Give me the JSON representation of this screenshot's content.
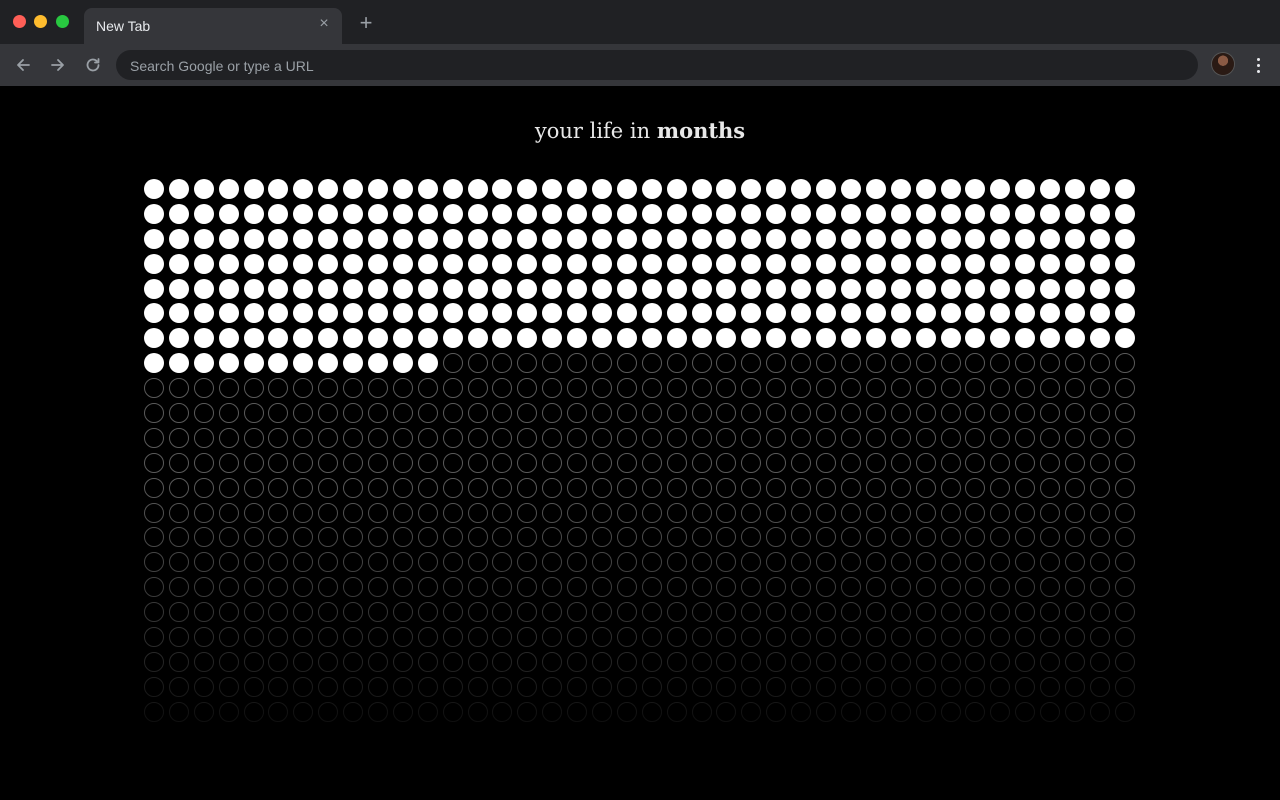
{
  "browser": {
    "tab_title": "New Tab",
    "omnibox_placeholder": "Search Google or type a URL"
  },
  "page": {
    "heading_prefix": "your life in ",
    "heading_bold": "months"
  },
  "grid": {
    "columns": 40,
    "months_lived": 292,
    "months_visible": 880,
    "colors": {
      "lived": "#ffffff",
      "future_outline": "#5a5a5a"
    }
  }
}
